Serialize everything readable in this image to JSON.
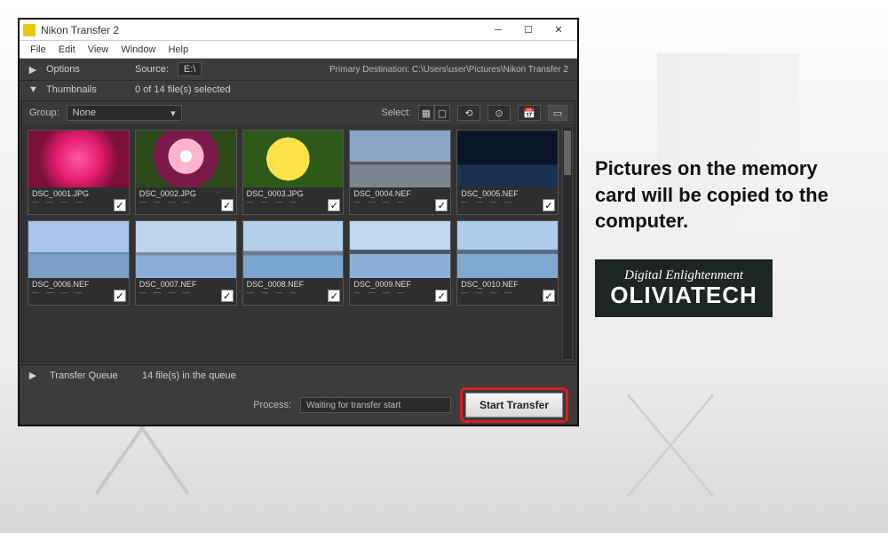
{
  "caption": {
    "text": "Pictures on the memory card will be copied to the computer.",
    "brand_tag": "Digital Enlightenment",
    "brand_name": "OLIVIATECH"
  },
  "window": {
    "title": "Nikon Transfer 2",
    "menus": [
      "File",
      "Edit",
      "View",
      "Window",
      "Help"
    ]
  },
  "options": {
    "arrow": "▶",
    "label": "Options",
    "source_label": "Source:",
    "source_value": "E:\\",
    "destination": "Primary Destination: C:\\Users\\user\\Pictures\\Nikon Transfer 2"
  },
  "thumbnails": {
    "arrow": "▼",
    "label": "Thumbnails",
    "status": "0 of 14 file(s) selected",
    "group_label": "Group:",
    "group_value": "None",
    "select_label": "Select:",
    "files": [
      {
        "name": "DSC_0001.JPG",
        "cls": "img-flower1"
      },
      {
        "name": "DSC_0002.JPG",
        "cls": "img-flower2"
      },
      {
        "name": "DSC_0003.JPG",
        "cls": "img-flower3"
      },
      {
        "name": "DSC_0004.NEF",
        "cls": "img-bridge"
      },
      {
        "name": "DSC_0005.NEF",
        "cls": "img-night"
      },
      {
        "name": "DSC_0006.NEF",
        "cls": "img-sky1"
      },
      {
        "name": "DSC_0007.NEF",
        "cls": "img-sky2"
      },
      {
        "name": "DSC_0008.NEF",
        "cls": "img-sky3"
      },
      {
        "name": "DSC_0009.NEF",
        "cls": "img-sky4"
      },
      {
        "name": "DSC_0010.NEF",
        "cls": "img-sky5"
      }
    ]
  },
  "queue": {
    "arrow": "▶",
    "label": "Transfer Queue",
    "status": "14 file(s) in the queue"
  },
  "process": {
    "label": "Process:",
    "value": "Waiting for transfer start",
    "button": "Start Transfer"
  }
}
